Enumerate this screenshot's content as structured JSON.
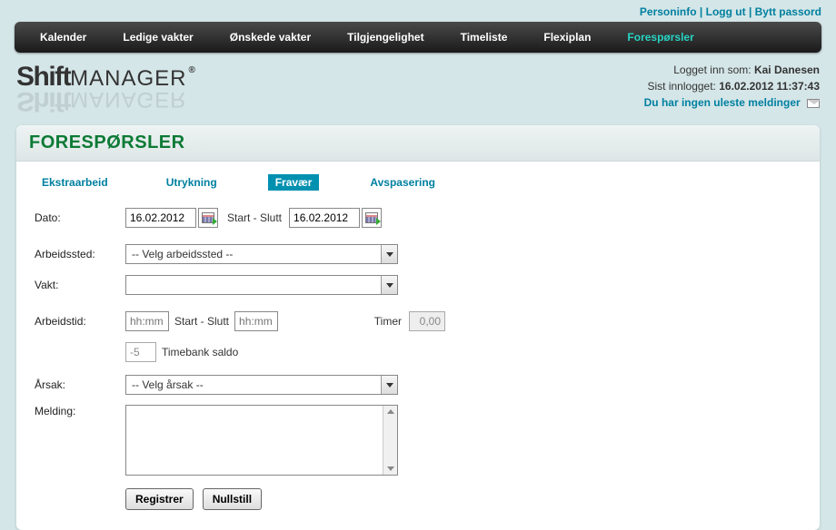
{
  "topLinks": {
    "personinfo": "Personinfo",
    "logout": "Logg ut",
    "changepw": "Bytt passord"
  },
  "nav": {
    "kalender": "Kalender",
    "ledige": "Ledige vakter",
    "onskede": "Ønskede vakter",
    "tilgj": "Tilgjengelighet",
    "timeliste": "Timeliste",
    "flexiplan": "Flexiplan",
    "foresporsler": "Forespørsler"
  },
  "logo": {
    "bold": "Shift",
    "thin": "MANAGER"
  },
  "userInfo": {
    "loggedInAsLabel": "Logget inn som:",
    "username": "Kai Danesen",
    "lastLoginLabel": "Sist innlogget:",
    "lastLogin": "16.02.2012 11:37:43",
    "noMessages": "Du har ingen uleste meldinger"
  },
  "panel": {
    "title": "FORESPØRSLER"
  },
  "tabs": {
    "ekstra": "Ekstraarbeid",
    "utrykning": "Utrykning",
    "fravaer": "Fravær",
    "avspasering": "Avspasering"
  },
  "form": {
    "datoLabel": "Dato:",
    "dateStart": "16.02.2012",
    "startSlutt": "Start  -  Slutt",
    "dateEnd": "16.02.2012",
    "arbeidsstedLabel": "Arbeidssted:",
    "arbeidsstedPlaceholder": "-- Velg arbeidssted --",
    "vaktLabel": "Vakt:",
    "vaktValue": "",
    "arbeidstidLabel": "Arbeidstid:",
    "timePlaceholder": "hh:mm",
    "startSlutt2": "Start - Slutt",
    "timerLabel": "Timer",
    "timerValue": "0,00",
    "timebankValue": "-5",
    "timebankLabel": "Timebank saldo",
    "arsakLabel": "Årsak:",
    "arsakPlaceholder": "-- Velg årsak --",
    "meldingLabel": "Melding:",
    "registerBtn": "Registrer",
    "nullstillBtn": "Nullstill"
  }
}
